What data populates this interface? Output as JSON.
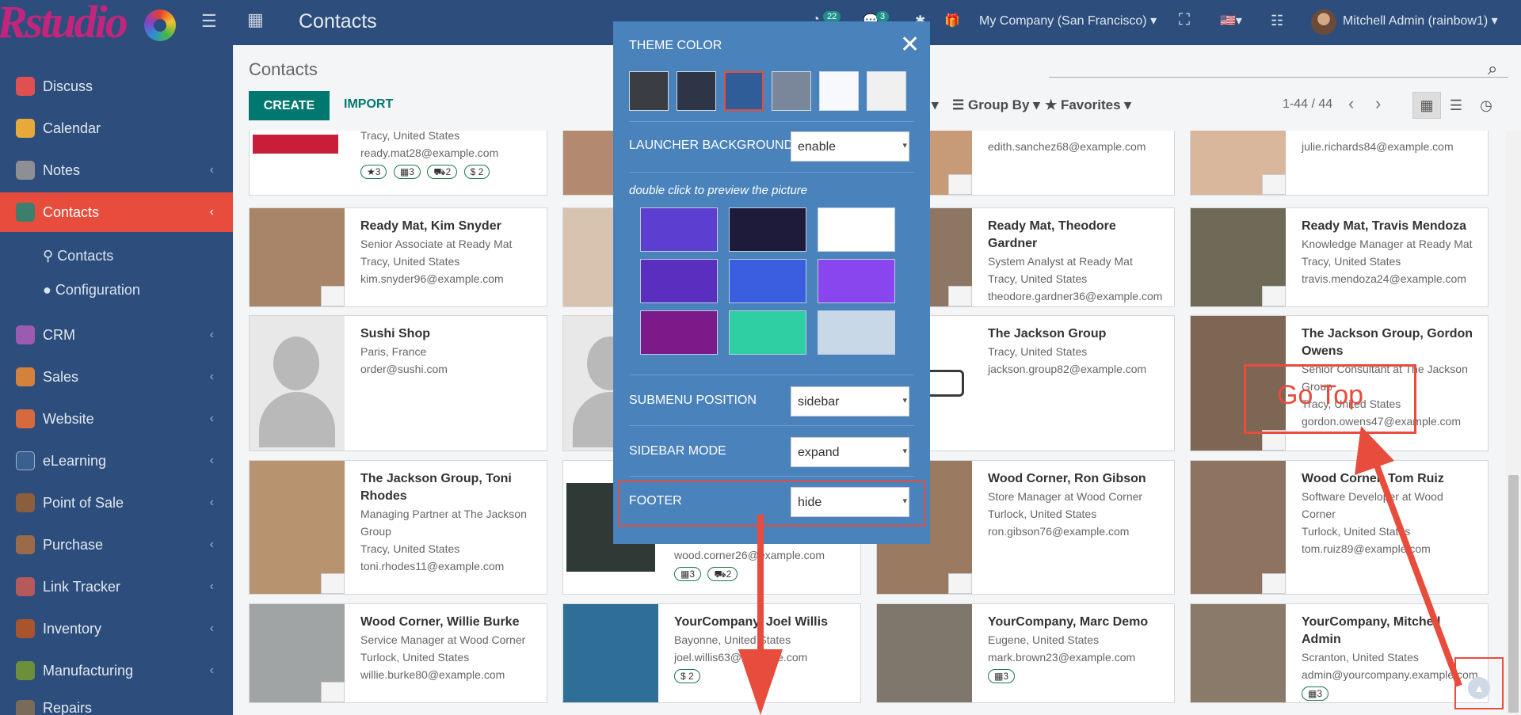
{
  "topbar": {
    "logo_text": "Rstudio",
    "app_title": "Contacts",
    "activity_count": "22",
    "message_count": "3",
    "company": "My Company (San Francisco)",
    "user": "Mitchell Admin (rainbow1)"
  },
  "sidebar": {
    "items": [
      {
        "label": "Discuss",
        "color": "#e05050"
      },
      {
        "label": "Calendar",
        "color": "#e6a93a"
      },
      {
        "label": "Notes",
        "color": "#8d8f95"
      },
      {
        "label": "Contacts",
        "color": "#3d7f6e"
      },
      {
        "label": "CRM",
        "color": "#9b5cb0"
      },
      {
        "label": "Sales",
        "color": "#d4813c"
      },
      {
        "label": "Website",
        "color": "#d66a3c"
      },
      {
        "label": "eLearning",
        "color": "#3a5f91"
      },
      {
        "label": "Point of Sale",
        "color": "#8b5e3c"
      },
      {
        "label": "Purchase",
        "color": "#9a6a4a"
      },
      {
        "label": "Link Tracker",
        "color": "#b55a5a"
      },
      {
        "label": "Inventory",
        "color": "#a9542c"
      },
      {
        "label": "Manufacturing",
        "color": "#6b8f3a"
      },
      {
        "label": "Repairs",
        "color": "#7a6a5a"
      }
    ],
    "sub_items": [
      "Contacts",
      "Configuration"
    ]
  },
  "control": {
    "breadcrumb": "Contacts",
    "create_label": "CREATE",
    "import_label": "IMPORT",
    "group_by": "Group By",
    "favorites": "Favorites",
    "pager": "1-44 / 44"
  },
  "cards": [
    {
      "name": "",
      "lines": [
        "Tracy, United States",
        "ready.mat28@example.com"
      ],
      "chips": [
        "★3",
        "▦3",
        "⛟2",
        "$ 2"
      ]
    },
    {
      "name": "",
      "lines": [
        "edith.sanchez68@example.com"
      ],
      "chips": []
    },
    {
      "name": "",
      "lines": [
        "julie.richards84@example.com"
      ],
      "chips": []
    },
    {
      "name": "Ready Mat, Kim Snyder",
      "lines": [
        "Senior Associate at Ready Mat",
        "Tracy, United States",
        "kim.snyder96@example.com"
      ],
      "chips": []
    },
    {
      "name": "Ready Mat, Theodore Gardner",
      "lines": [
        "System Analyst at Ready Mat",
        "Tracy, United States",
        "theodore.gardner36@example.com"
      ],
      "chips": []
    },
    {
      "name": "Ready Mat, Travis Mendoza",
      "lines": [
        "Knowledge Manager at Ready Mat",
        "Tracy, United States",
        "travis.mendoza24@example.com"
      ],
      "chips": []
    },
    {
      "name": "Sushi Shop",
      "lines": [
        "Paris, France",
        "order@sushi.com"
      ],
      "chips": []
    },
    {
      "name": "The Jackson Group",
      "lines": [
        "Tracy, United States",
        "jackson.group82@example.com"
      ],
      "chips": []
    },
    {
      "name": "The Jackson Group, Gordon Owens",
      "lines": [
        "Senior Consultant at The Jackson Group",
        "Tracy, United States",
        "gordon.owens47@example.com"
      ],
      "chips": []
    },
    {
      "name": "The Jackson Group, Toni Rhodes",
      "lines": [
        "Managing Partner at The Jackson Group",
        "Tracy, United States",
        "toni.rhodes11@example.com"
      ],
      "chips": []
    },
    {
      "name": "",
      "lines": [
        "wood.corner26@example.com"
      ],
      "chips": [
        "▦3",
        "⛟2"
      ]
    },
    {
      "name": "Wood Corner, Ron Gibson",
      "lines": [
        "Store Manager at Wood Corner",
        "Turlock, United States",
        "ron.gibson76@example.com"
      ],
      "chips": []
    },
    {
      "name": "Wood Corner, Tom Ruiz",
      "lines": [
        "Software Developer at Wood Corner",
        "Turlock, United States",
        "tom.ruiz89@example.com"
      ],
      "chips": []
    },
    {
      "name": "Wood Corner, Willie Burke",
      "lines": [
        "Service Manager at Wood Corner",
        "Turlock, United States",
        "willie.burke80@example.com"
      ],
      "chips": []
    },
    {
      "name": "YourCompany, Joel Willis",
      "lines": [
        "Bayonne, United States",
        "joel.willis63@example.com"
      ],
      "chips": [
        "$ 2"
      ]
    },
    {
      "name": "YourCompany, Marc Demo",
      "lines": [
        "Eugene, United States",
        "mark.brown23@example.com"
      ],
      "chips": [
        "▦3"
      ]
    },
    {
      "name": "YourCompany, Mitchell Admin",
      "lines": [
        "Scranton, United States",
        "admin@yourcompany.example.com"
      ],
      "chips": [
        "▦3"
      ]
    }
  ],
  "theme_panel": {
    "title": "THEME COLOR",
    "swatches": [
      "#3a3d42",
      "#2d3547",
      "#2e5d97",
      "#7a8699",
      "#f7f9fc",
      "#f0f0f0"
    ],
    "launcher_label": "LAUNCHER BACKGROUND",
    "launcher_value": "enable",
    "hint": "double click to preview the picture",
    "backgrounds": [
      "#5c3fd0",
      "#1d1a3a",
      "#ffffff",
      "#5a2fc0",
      "#3b5ee0",
      "#8a46ee",
      "#7d1a8a",
      "#2ecfa3",
      "#c9d8e6"
    ],
    "submenu_label": "SUBMENU POSITION",
    "submenu_value": "sidebar",
    "sidebar_label": "SIDEBAR MODE",
    "sidebar_value": "expand",
    "footer_label": "FOOTER",
    "footer_value": "hide"
  },
  "annotations": {
    "go_top": "Go Top"
  }
}
